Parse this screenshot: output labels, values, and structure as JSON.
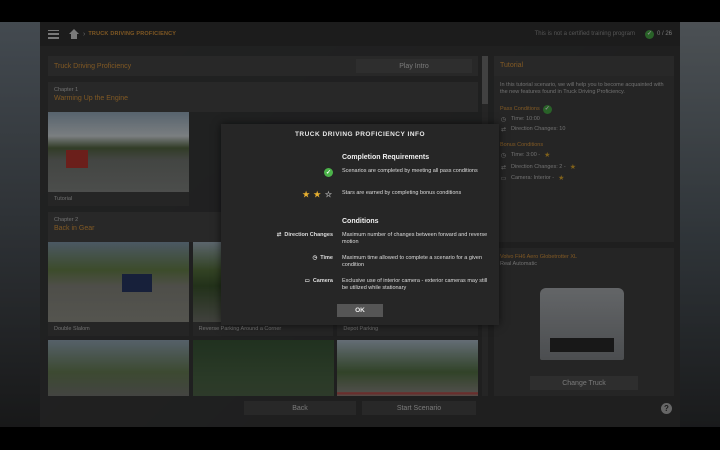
{
  "topbar": {
    "breadcrumb": "TRUCK DRIVING PROFICIENCY",
    "disclaimer": "This is not a certified training program",
    "progress": "0 / 26"
  },
  "left": {
    "header_title": "Truck Driving Proficiency",
    "play_intro": "Play Intro",
    "chapters": [
      {
        "number": "Chapter 1",
        "name": "Warming Up the Engine",
        "scenarios": [
          "Tutorial"
        ]
      },
      {
        "number": "Chapter 2",
        "name": "Back in Gear",
        "scenarios": [
          "Double Slalom",
          "Reverse Parking Around a Corner",
          "Depot Parking"
        ]
      }
    ]
  },
  "right": {
    "title": "Tutorial",
    "description": "In this tutorial scenario, we will help you to become acquainted with the new features found in Truck Driving Proficiency.",
    "pass_conditions_label": "Pass Conditions",
    "pass_time": "Time: 10:00",
    "pass_direction": "Direction Changes: 10",
    "bonus_conditions_label": "Bonus Conditions",
    "bonus_time": "Time: 3:00 -",
    "bonus_direction": "Direction Changes: 2 -",
    "bonus_camera": "Camera: Interior -",
    "truck_name": "Volvo FH6 Aero Globetrotter XL",
    "truck_sub": "Real Automatic",
    "change_truck": "Change Truck"
  },
  "bottom": {
    "back": "Back",
    "start": "Start Scenario",
    "help": "?"
  },
  "modal": {
    "title": "TRUCK DRIVING PROFICIENCY INFO",
    "completion_heading": "Completion Requirements",
    "completion_text": "Scenarios are completed by meeting all pass conditions",
    "stars_text": "Stars are earned by completing bonus conditions",
    "conditions_heading": "Conditions",
    "direction_label": "Direction Changes",
    "direction_text": "Maximum number of changes between forward and reverse motion",
    "time_label": "Time",
    "time_text": "Maximum time allowed to complete a scenario for a given condition",
    "camera_label": "Camera",
    "camera_text": "Exclusive use of interior camera - exterior cameras may still be utilized while stationary",
    "ok": "OK",
    "stars_filled": 2,
    "stars_total": 3
  },
  "colors": {
    "accent": "#e8a040",
    "success": "#4cb34a",
    "star": "#e8b030"
  }
}
